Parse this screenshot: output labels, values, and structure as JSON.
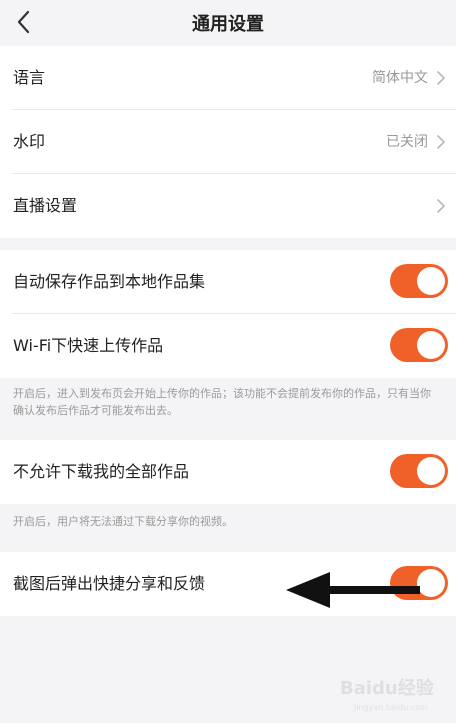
{
  "header": {
    "title": "通用设置",
    "back_icon": "chevron-left-icon"
  },
  "group1": {
    "rows": [
      {
        "label": "语言",
        "value": "简体中文"
      },
      {
        "label": "水印",
        "value": "已关闭"
      },
      {
        "label": "直播设置",
        "value": ""
      }
    ]
  },
  "group2": {
    "rows": [
      {
        "label": "自动保存作品到本地作品集",
        "toggle": true
      },
      {
        "label": "Wi-Fi下快速上传作品",
        "toggle": true
      }
    ],
    "note": "开启后，进入到发布页会开始上传你的作品；该功能不会提前发布你的作品，只有当你确认发布后作品才可能发布出去。"
  },
  "group3": {
    "rows": [
      {
        "label": "不允许下载我的全部作品",
        "toggle": true
      }
    ],
    "note": "开启后，用户将无法通过下载分享你的视频。"
  },
  "group4": {
    "rows": [
      {
        "label": "截图后弹出快捷分享和反馈",
        "toggle": true
      }
    ]
  },
  "colors": {
    "accent": "#f0612a",
    "background": "#f4f4f6"
  },
  "watermark": {
    "text": "Baidu经验",
    "url": "jingyan.baidu.com"
  }
}
